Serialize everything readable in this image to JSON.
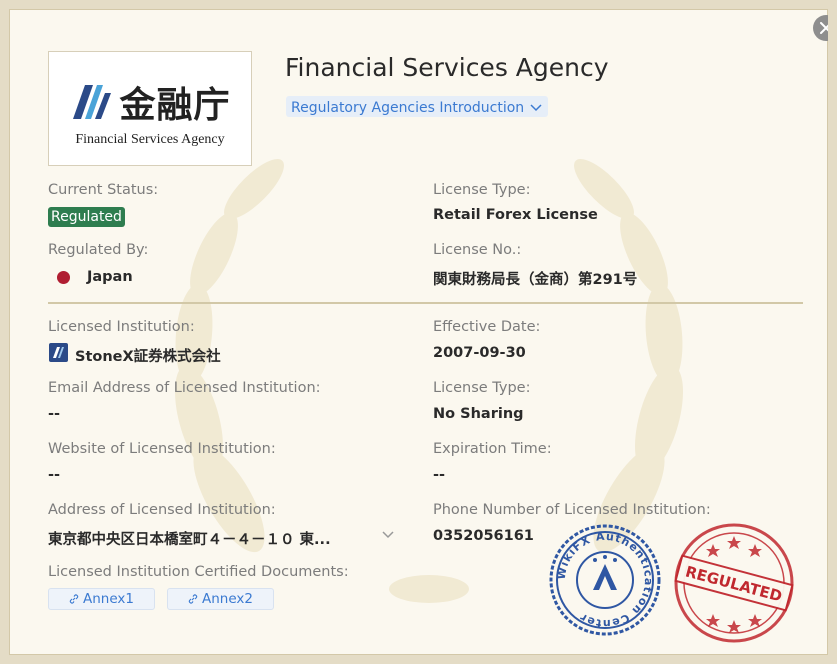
{
  "agency": {
    "title": "Financial Services Agency",
    "intro_label": "Regulatory Agencies Introduction",
    "logo_kanji": "金融庁",
    "logo_en": "Financial Services Agency"
  },
  "left_fields": {
    "current_status_label": "Current Status:",
    "current_status_value": "Regulated",
    "regulated_by_label": "Regulated By:",
    "regulated_by_value": "Japan",
    "licensed_institution_label": "Licensed Institution:",
    "licensed_institution_value": "StoneX証券株式会社",
    "email_label": "Email Address of Licensed Institution:",
    "email_value": "--",
    "website_label": "Website of Licensed Institution:",
    "website_value": "--",
    "address_label": "Address of Licensed Institution:",
    "address_value": "東京都中央区日本橋室町４－４－１０ 東...",
    "documents_label": "Licensed Institution Certified Documents:",
    "documents": [
      "Annex1",
      "Annex2"
    ]
  },
  "right_fields": {
    "license_type_label": "License Type:",
    "license_type_value": "Retail Forex License",
    "license_no_label": "License No.:",
    "license_no_value": "関東財務局長（金商）第291号",
    "effective_date_label": "Effective Date:",
    "effective_date_value": "2007-09-30",
    "license_type2_label": "License Type:",
    "license_type2_value": "No Sharing",
    "expiration_label": "Expiration Time:",
    "expiration_value": "--",
    "phone_label": "Phone Number of Licensed Institution:",
    "phone_value": "0352056161"
  },
  "stamps": {
    "wikifx_text": "WikiFX Authentication Center",
    "regulated_text": "REGULATED"
  },
  "colors": {
    "status_green": "#2e7d4f",
    "link_blue": "#3b7ad1",
    "flag_red": "#b01e32",
    "stamp_blue": "#2f57a3",
    "stamp_red": "#c0282e"
  }
}
